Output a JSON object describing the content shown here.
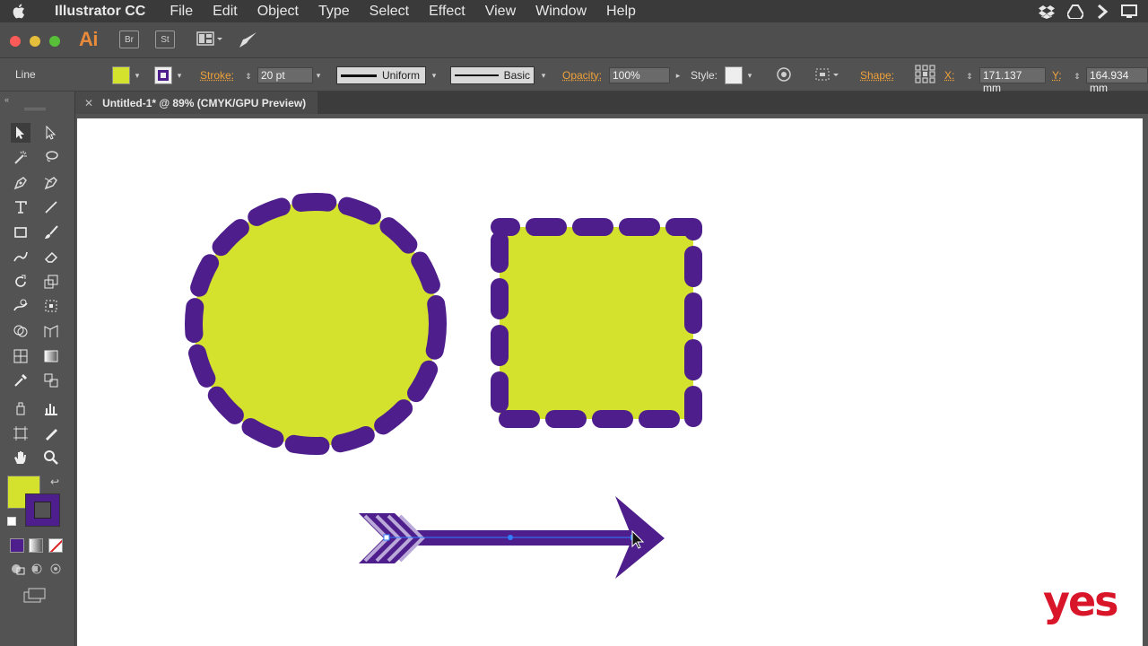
{
  "menubar": {
    "app_name": "Illustrator CC",
    "menus": [
      "File",
      "Edit",
      "Object",
      "Type",
      "Select",
      "Effect",
      "View",
      "Window",
      "Help"
    ]
  },
  "appbar": {
    "logo": "Ai",
    "bridge": "Br",
    "stock": "St"
  },
  "control": {
    "selection_type": "Line",
    "stroke_label": "Stroke:",
    "stroke_weight": "20 pt",
    "profile": "Uniform",
    "brush": "Basic",
    "opacity_label": "Opacity:",
    "opacity_value": "100%",
    "style_label": "Style:",
    "shape_label": "Shape:",
    "x_label": "X:",
    "x_value": "171.137 mm",
    "y_label": "Y:",
    "y_value": "164.934 mm",
    "fill_color": "#d4e22e",
    "stroke_color": "#4e1f8c"
  },
  "document": {
    "tab_title": "Untitled-1* @ 89% (CMYK/GPU Preview)"
  },
  "colors": {
    "fill": "#d4e22e",
    "stroke": "#4e1f8c",
    "arrow": "#4e1f8c",
    "arrow_light": "#b9a8d8"
  },
  "watermark": "yes"
}
